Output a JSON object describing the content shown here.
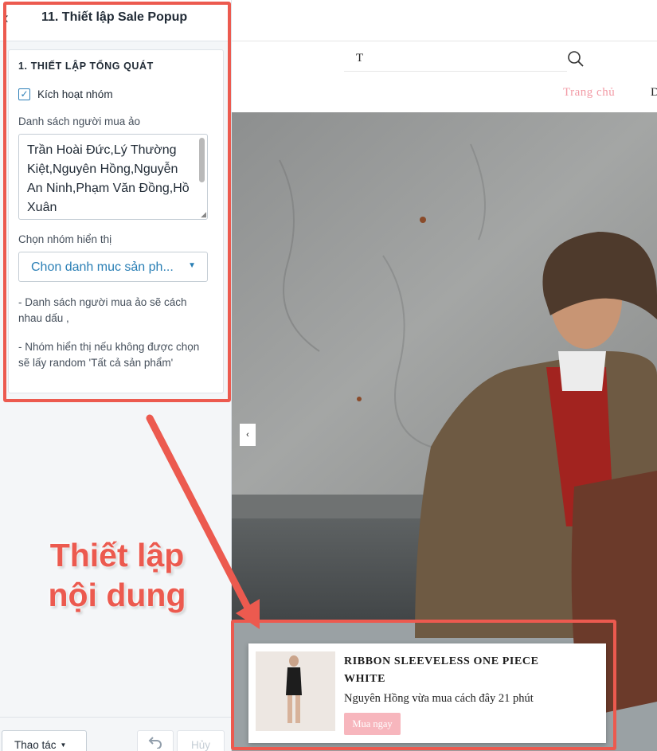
{
  "panel": {
    "title": "11. Thiết lập Sale Popup",
    "section_title": "1. THIẾT LẬP TỔNG QUÁT",
    "activate_label": "Kích hoạt nhóm",
    "activate_checked": true,
    "buyers_label": "Danh sách người mua ảo",
    "buyers_value": "Trần Hoài Đức,Lý Thường Kiệt,Nguyên Hồng,Nguyễn An Ninh,Phạm Văn Đồng,Hồ Xuân",
    "group_label": "Chọn nhóm hiển thị",
    "group_select": "Chon danh muc sản ph...",
    "note1": "- Danh sách người mua ảo sẽ cách nhau dấu ,",
    "note2": "- Nhóm hiển thị nếu không được chọn sẽ lấy random 'Tất cả sản phẩm'",
    "footer": {
      "action_label": "Thao tác",
      "cancel_label": "Hủy"
    }
  },
  "store": {
    "search_value": "T",
    "nav": {
      "home": "Trang chủ",
      "next": "D"
    },
    "popup": {
      "product_name": "RIBBON SLEEVELESS ONE PIECE WHITE",
      "message": "Nguyên Hồng vừa mua cách đây 21 phút",
      "buy_label": "Mua ngay"
    }
  },
  "annotation": {
    "line1": "Thiết lập",
    "line2": "nội dung",
    "color": "#ec5a4f"
  },
  "colors": {
    "accent_blue": "#2a7fb5",
    "pink": "#f29aa5",
    "button_pink": "#f7b6bd"
  }
}
